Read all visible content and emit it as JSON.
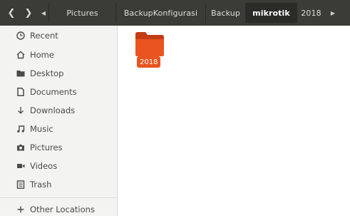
{
  "nav": {
    "back_icon": "chevron-left-icon",
    "forward_icon": "chevron-right-icon",
    "breadcrumb_left_arrow": "arrow-left-icon",
    "breadcrumb_right_arrow": "arrow-right-icon"
  },
  "breadcrumb": [
    {
      "label": "Pictures"
    },
    {
      "label": "BackupKonfigurasi"
    },
    {
      "label": "Backup"
    },
    {
      "label": "mikrotik"
    },
    {
      "label": "2018"
    }
  ],
  "sidebar": {
    "items": [
      {
        "label": "Recent",
        "icon": "clock-icon"
      },
      {
        "label": "Home",
        "icon": "home-icon"
      },
      {
        "label": "Desktop",
        "icon": "desktop-folder-icon"
      },
      {
        "label": "Documents",
        "icon": "document-icon"
      },
      {
        "label": "Downloads",
        "icon": "download-icon"
      },
      {
        "label": "Music",
        "icon": "music-icon"
      },
      {
        "label": "Pictures",
        "icon": "camera-icon"
      },
      {
        "label": "Videos",
        "icon": "video-icon"
      },
      {
        "label": "Trash",
        "icon": "trash-icon"
      },
      {
        "label": "Other Locations",
        "icon": "plus-icon"
      }
    ]
  },
  "content": {
    "items": [
      {
        "name": "2018",
        "icon": "folder-icon"
      }
    ]
  },
  "colors": {
    "toolbar": "#3b3b37",
    "accent": "#e95420",
    "sidebar": "#f3f3f1"
  }
}
